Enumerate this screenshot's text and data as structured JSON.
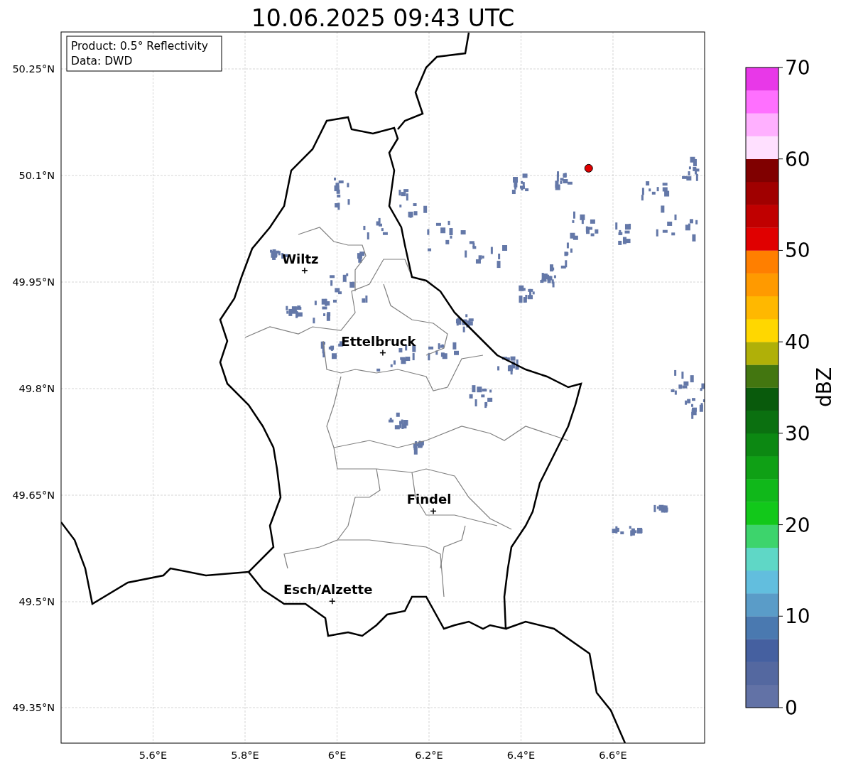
{
  "title": "10.06.2025 09:43 UTC",
  "info_box": [
    "Product: 0.5° Reflectivity",
    "Data: DWD"
  ],
  "map": {
    "x_ticks": [
      "5.6°E",
      "5.8°E",
      "6°E",
      "6.2°E",
      "6.4°E",
      "6.6°E"
    ],
    "y_ticks": [
      "50.25°N",
      "50.1°N",
      "49.95°N",
      "49.8°N",
      "49.65°N",
      "49.5°N",
      "49.35°N"
    ],
    "cities": [
      {
        "name": "Wiltz"
      },
      {
        "name": "Ettelbruck"
      },
      {
        "name": "Findel"
      },
      {
        "name": "Esch/Alzette"
      }
    ]
  },
  "colorbar": {
    "label": "dBZ",
    "ticks": [
      "70",
      "60",
      "50",
      "40",
      "30",
      "20",
      "10",
      "0"
    ],
    "segments": [
      {
        "color": "#6272a6"
      },
      {
        "color": "#5468a0"
      },
      {
        "color": "#4560a0"
      },
      {
        "color": "#4a79b0"
      },
      {
        "color": "#5a9cc8"
      },
      {
        "color": "#62bede"
      },
      {
        "color": "#5fd7c6"
      },
      {
        "color": "#3dd46c"
      },
      {
        "color": "#12c81a"
      },
      {
        "color": "#10b81a"
      },
      {
        "color": "#0fa015"
      },
      {
        "color": "#0c8812"
      },
      {
        "color": "#0b7010"
      },
      {
        "color": "#095a0c"
      },
      {
        "color": "#437610"
      },
      {
        "color": "#b0b008"
      },
      {
        "color": "#ffd700"
      },
      {
        "color": "#ffb800"
      },
      {
        "color": "#ff9a00"
      },
      {
        "color": "#ff7f00"
      },
      {
        "color": "#e00000"
      },
      {
        "color": "#c00000"
      },
      {
        "color": "#a00000"
      },
      {
        "color": "#800000"
      },
      {
        "color": "#ffe0ff"
      },
      {
        "color": "#ffb0ff"
      },
      {
        "color": "#ff70ff"
      },
      {
        "color": "#e838e8"
      }
    ]
  }
}
